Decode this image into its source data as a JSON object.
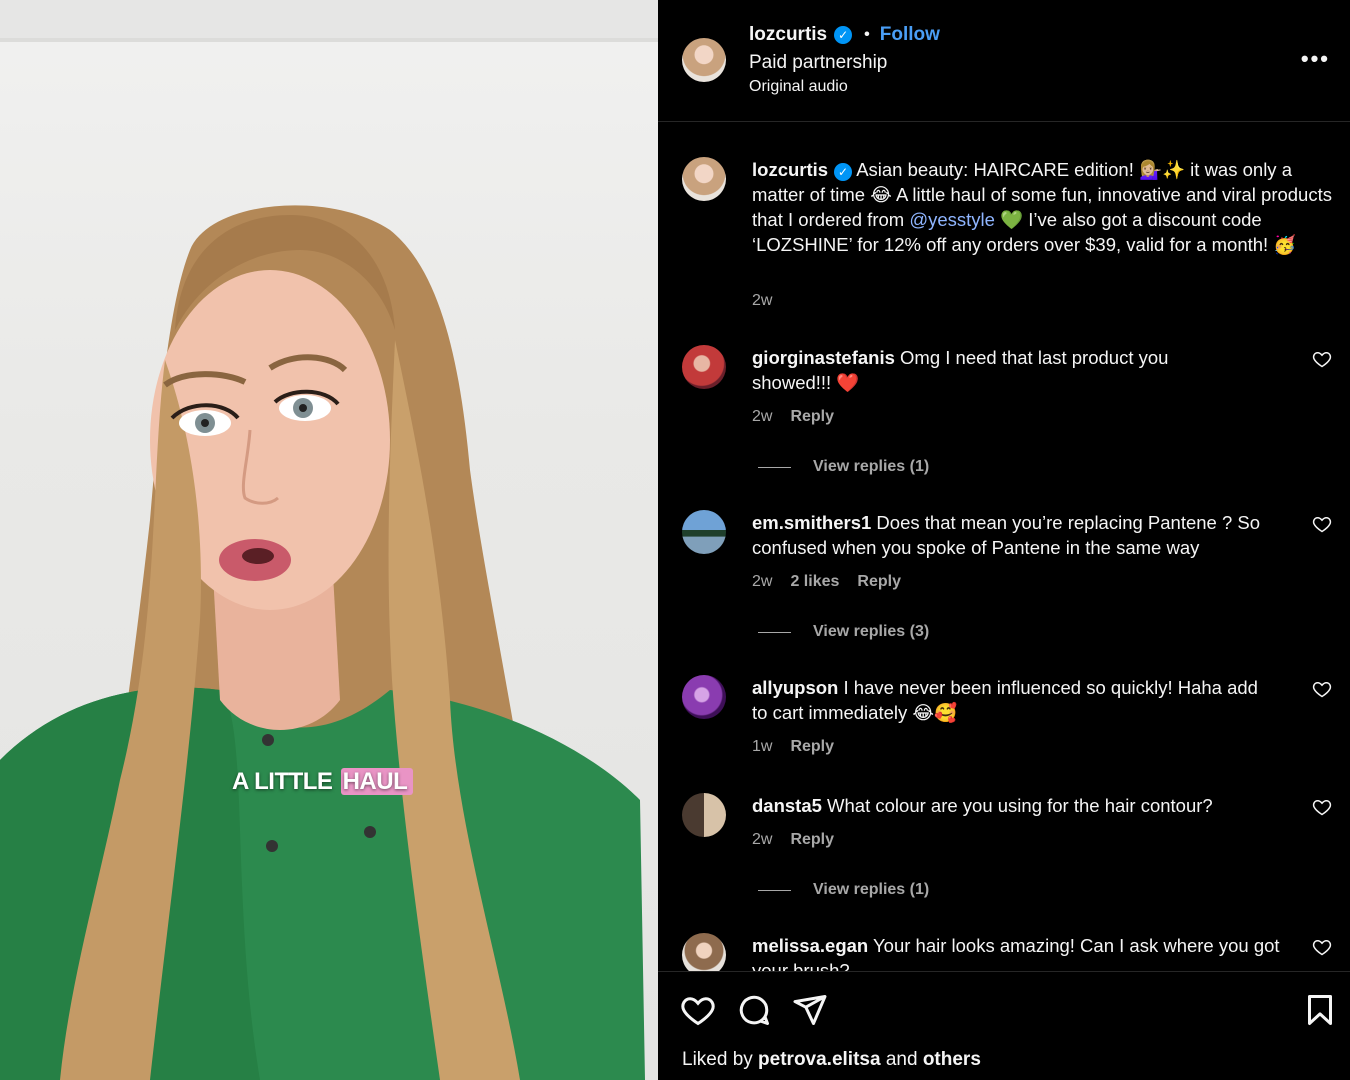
{
  "video": {
    "caption_plain": "A LITTLE ",
    "caption_highlight": "HAUL"
  },
  "header": {
    "username": "lozcurtis",
    "verified_icon": "verified-badge-icon",
    "separator": "•",
    "follow_label": "Follow",
    "subtitle": "Paid partnership",
    "audio": "Original audio",
    "more_label": "•••"
  },
  "caption": {
    "username": "lozcurtis",
    "text_1": " Asian beauty: HAIRCARE edition! 💁🏼‍♀️✨ it was only a matter of time 😂 A little haul of some fun, innovative and viral products that I ordered from ",
    "mention": "@yesstyle",
    "text_2": " 💚 I’ve also got a discount code ‘LOZSHINE’ for 12% off any orders over $39, valid for a month! 🥳",
    "time": "2w"
  },
  "comments": [
    {
      "username": "giorginastefanis",
      "text": " Omg I need that last product you showed!!! ❤️",
      "time": "2w",
      "likes": "",
      "reply_label": "Reply",
      "view_replies": "View replies (1)"
    },
    {
      "username": "em.smithers1",
      "text": " Does that mean you’re replacing Pantene ? So confused when you spoke of Pantene in the same way",
      "time": "2w",
      "likes": "2 likes",
      "reply_label": "Reply",
      "view_replies": "View replies (3)"
    },
    {
      "username": "allyupson",
      "text": " I have never been influenced so quickly! Haha add to cart immediately 😂🥰",
      "time": "1w",
      "likes": "",
      "reply_label": "Reply",
      "view_replies": ""
    },
    {
      "username": "dansta5",
      "text": " What colour are you using for the hair contour?",
      "time": "2w",
      "likes": "",
      "reply_label": "Reply",
      "view_replies": "View replies (1)"
    },
    {
      "username": "melissa.egan",
      "text": " Your hair looks amazing! Can I ask where you got your brush?",
      "time": "",
      "likes": "",
      "reply_label": "",
      "view_replies": ""
    }
  ],
  "actions": {
    "icons": [
      "heart-icon",
      "comment-icon",
      "share-icon",
      "bookmark-icon"
    ],
    "liked_prefix": "Liked by ",
    "liked_user": "petrova.elitsa",
    "liked_mid": " and ",
    "liked_others": "others"
  },
  "colors": {
    "background": "#000000",
    "text": "#f5f5f5",
    "secondary": "#a8a8a8",
    "follow": "#4a9ef5",
    "mention": "#8fb5ff",
    "verified": "#0095f6",
    "caption_highlight": "#e994c5"
  }
}
